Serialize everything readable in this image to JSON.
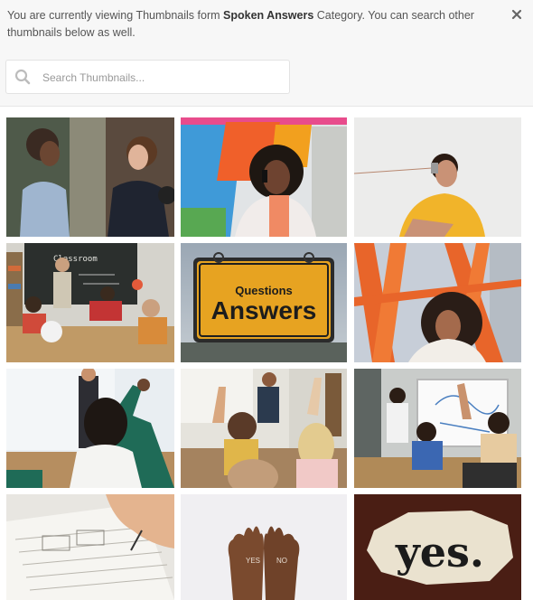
{
  "notice": {
    "prefix": "You are currently viewing Thumbnails form ",
    "category": "Spoken Answers",
    "suffix": " Category. You can search other thumbnails below as well."
  },
  "close_icon": "close-icon",
  "search": {
    "placeholder": "Search Thumbnails...",
    "value": "",
    "icon": "search-icon"
  },
  "thumbnails": [
    {
      "name": "thumb-two-women-talking",
      "text": []
    },
    {
      "name": "thumb-woman-on-phone",
      "text": []
    },
    {
      "name": "thumb-man-tin-can-phone",
      "text": []
    },
    {
      "name": "thumb-classroom-blackboard",
      "text": [
        "Classroom"
      ]
    },
    {
      "name": "thumb-questions-answers-sign",
      "text": [
        "Questions",
        "Answers"
      ]
    },
    {
      "name": "thumb-woman-orange-structure",
      "text": []
    },
    {
      "name": "thumb-student-raising-hand",
      "text": []
    },
    {
      "name": "thumb-classroom-hands-raised",
      "text": []
    },
    {
      "name": "thumb-whiteboard-lesson",
      "text": []
    },
    {
      "name": "thumb-writing-test",
      "text": []
    },
    {
      "name": "thumb-hands-yes-no",
      "text": [
        "YES",
        "NO"
      ]
    },
    {
      "name": "thumb-yes-paper",
      "text": [
        "yes."
      ]
    }
  ],
  "colors": {
    "header_bg": "#f7f7f7",
    "sign_yellow": "#e7a321",
    "orange": "#e8652a"
  }
}
